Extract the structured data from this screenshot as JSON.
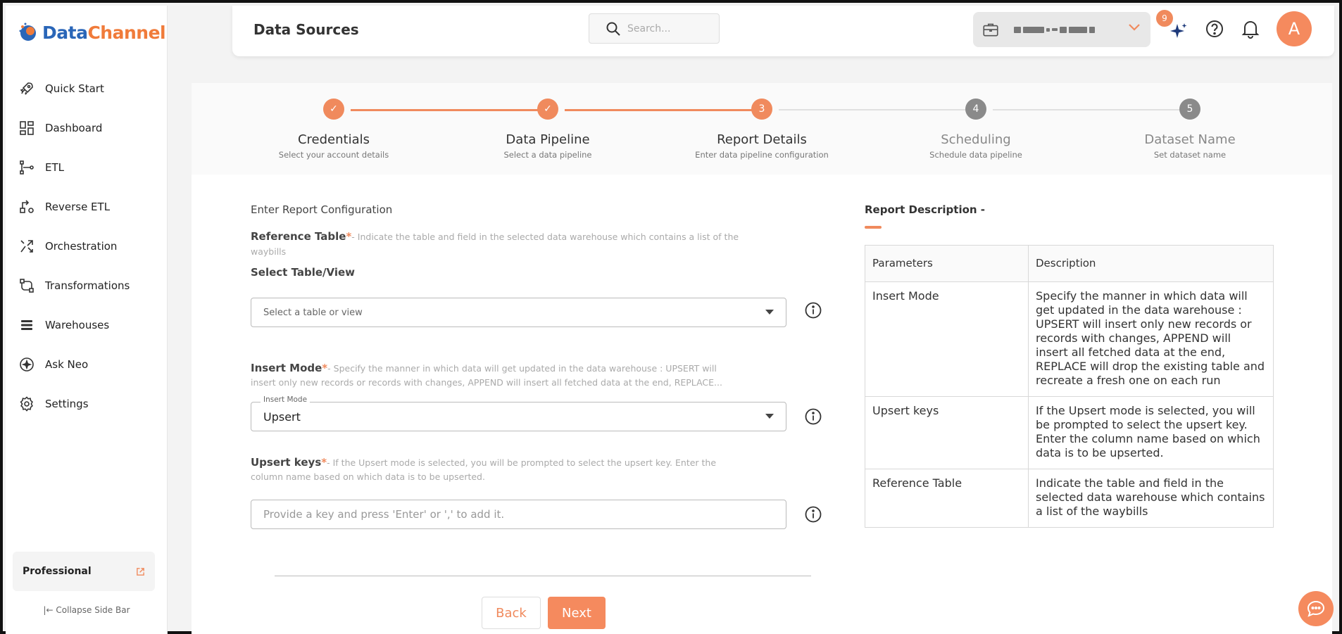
{
  "brand": {
    "name_part1": "Data",
    "name_part2": "Channel"
  },
  "sidebar": {
    "items": [
      {
        "label": "Quick Start",
        "icon": "rocket-icon"
      },
      {
        "label": "Dashboard",
        "icon": "dashboard-icon"
      },
      {
        "label": "ETL",
        "icon": "etl-icon"
      },
      {
        "label": "Reverse ETL",
        "icon": "reverse-etl-icon"
      },
      {
        "label": "Orchestration",
        "icon": "orchestration-icon"
      },
      {
        "label": "Transformations",
        "icon": "transformations-icon"
      },
      {
        "label": "Warehouses",
        "icon": "warehouses-icon"
      },
      {
        "label": "Ask Neo",
        "icon": "ask-neo-icon"
      },
      {
        "label": "Settings",
        "icon": "gear-icon"
      }
    ],
    "plan": "Professional",
    "collapse": "Collapse Side Bar"
  },
  "header": {
    "title": "Data Sources",
    "search_placeholder": "Search...",
    "notification_count": "9",
    "avatar_initial": "A"
  },
  "stepper": {
    "steps": [
      {
        "number": "1",
        "title": "Credentials",
        "subtitle": "Select your account details",
        "state": "done"
      },
      {
        "number": "2",
        "title": "Data Pipeline",
        "subtitle": "Select a data pipeline",
        "state": "done"
      },
      {
        "number": "3",
        "title": "Report Details",
        "subtitle": "Enter data pipeline configuration",
        "state": "active"
      },
      {
        "number": "4",
        "title": "Scheduling",
        "subtitle": "Schedule data pipeline",
        "state": "pending"
      },
      {
        "number": "5",
        "title": "Dataset Name",
        "subtitle": "Set dataset name",
        "state": "pending"
      }
    ]
  },
  "form": {
    "heading": "Enter Report Configuration",
    "reference_table": {
      "label": "Reference Table",
      "required": "*",
      "desc_line1": "- Indicate the table and field in the selected data warehouse which contains a list of the",
      "desc_line2": "waybills",
      "select_label": "Select Table/View",
      "placeholder": "Select a table or view"
    },
    "insert_mode": {
      "label": "Insert Mode",
      "required": "*",
      "desc_line1": "- Specify the manner in which data will get updated in the data warehouse : UPSERT will",
      "desc_line2": "insert only new records or records with changes, APPEND will insert all fetched data at the end, REPLACE...",
      "float_label": "Insert Mode",
      "value": "Upsert"
    },
    "upsert_keys": {
      "label": "Upsert keys",
      "required": "*",
      "desc_line1": "- If the Upsert mode is selected, you will be prompted to select the upsert key. Enter the",
      "desc_line2": "column name based on which data is to be upserted.",
      "placeholder": "Provide a key and press 'Enter' or ',' to add it."
    },
    "back_label": "Back",
    "next_label": "Next"
  },
  "description": {
    "title": "Report Description -",
    "columns": [
      "Parameters",
      "Description"
    ],
    "rows": [
      {
        "param": "Insert Mode",
        "desc": "Specify the manner in which data will get updated in the data warehouse : UPSERT will insert only new records or records with changes, APPEND will insert all fetched data at the end, REPLACE will drop the existing table and recreate a fresh one on each run"
      },
      {
        "param": "Upsert keys",
        "desc": "If the Upsert mode is selected, you will be prompted to select the upsert key. Enter the column name based on which data is to be upserted."
      },
      {
        "param": "Reference Table",
        "desc": "Indicate the table and field in the selected data warehouse which contains a list of the waybills"
      }
    ]
  },
  "colors": {
    "accent": "#f08a5d",
    "brand_blue": "#2a66b8",
    "pending": "#8a8a8a"
  }
}
